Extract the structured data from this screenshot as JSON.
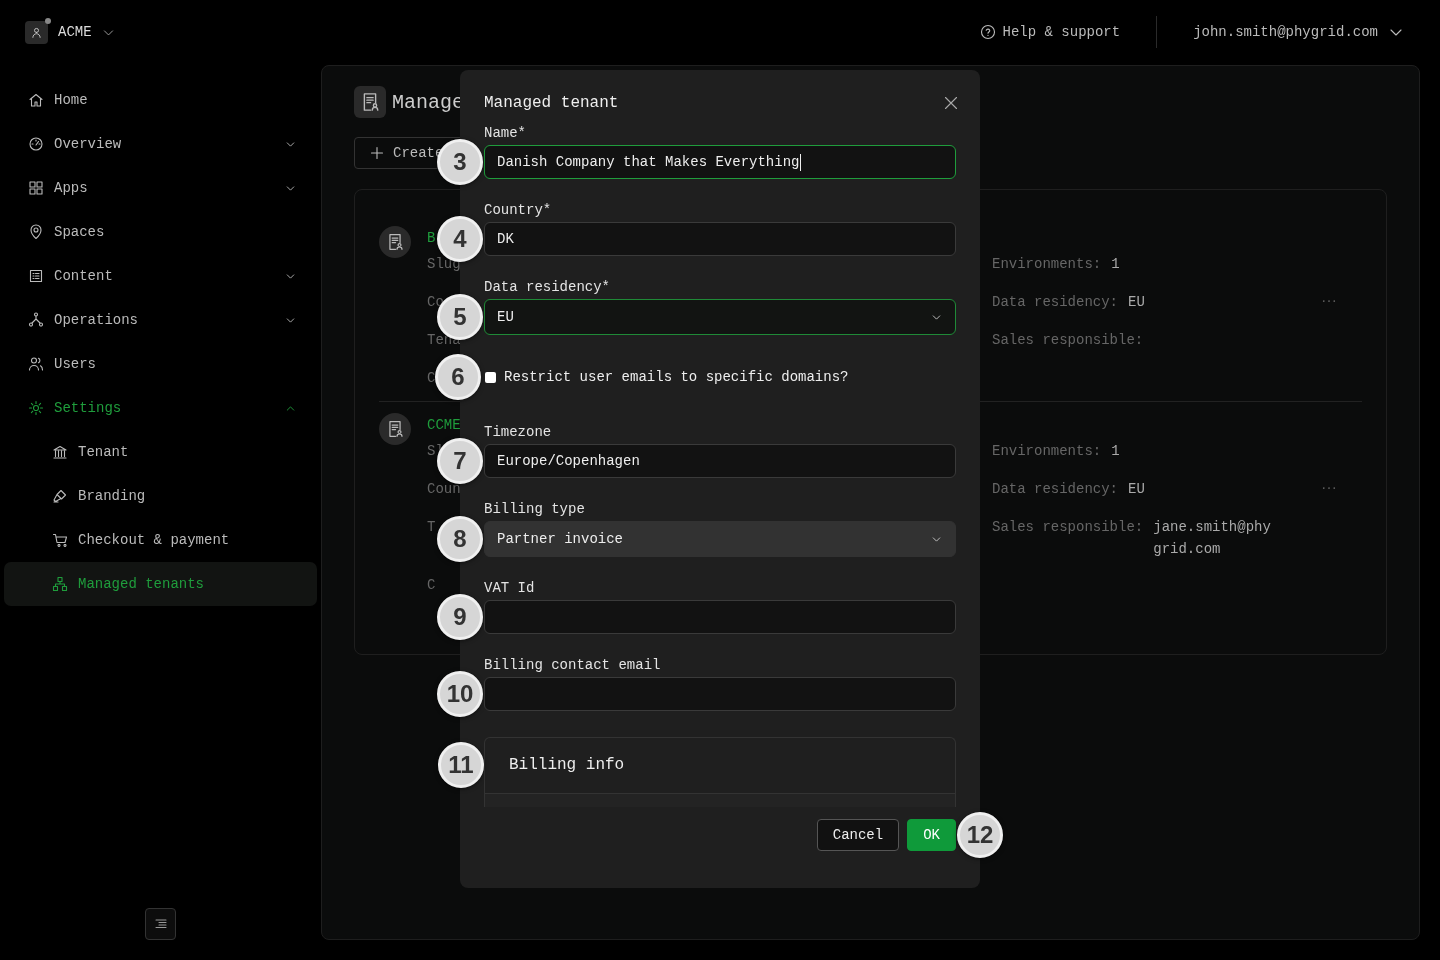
{
  "topbar": {
    "workspace": "ACME",
    "help": "Help & support",
    "user": "john.smith@phygrid.com"
  },
  "sidebar": {
    "items": [
      {
        "label": "Home",
        "kind": "link",
        "selected": false
      },
      {
        "label": "Overview",
        "kind": "group",
        "expanded": false,
        "selected": false
      },
      {
        "label": "Apps",
        "kind": "group",
        "expanded": false,
        "selected": false
      },
      {
        "label": "Spaces",
        "kind": "link",
        "selected": false
      },
      {
        "label": "Content",
        "kind": "group",
        "expanded": false,
        "selected": false
      },
      {
        "label": "Operations",
        "kind": "group",
        "expanded": false,
        "selected": false
      },
      {
        "label": "Users",
        "kind": "link",
        "selected": false
      },
      {
        "label": "Settings",
        "kind": "group",
        "expanded": true,
        "selected": true,
        "children": [
          {
            "label": "Tenant",
            "selected": false
          },
          {
            "label": "Branding",
            "selected": false
          },
          {
            "label": "Checkout & payment",
            "selected": false
          },
          {
            "label": "Managed tenants",
            "selected": true
          }
        ]
      }
    ]
  },
  "page": {
    "title": "Manage",
    "create_button": "Create",
    "tenants": [
      {
        "name": "B",
        "lines": [
          "Slug",
          "Co",
          "Tena",
          "C"
        ],
        "details": [
          {
            "label": "Environments:",
            "value": "1"
          },
          {
            "label": "Data residency:",
            "value": "EU"
          },
          {
            "label": "Sales responsible:"
          }
        ]
      },
      {
        "name": "CCME",
        "lines": [
          "Sl",
          "Coun",
          "T",
          "C"
        ],
        "details": [
          {
            "label": "Environments:",
            "value": "1"
          },
          {
            "label": "Data residency:",
            "value": "EU"
          },
          {
            "label": "Sales responsible:",
            "value": "jane.smith@phygrid.com"
          }
        ]
      }
    ]
  },
  "modal": {
    "title": "Managed tenant",
    "fields": [
      {
        "kind": "text",
        "label": "Name*",
        "value": "Danish Company that Makes Everything",
        "focused": true,
        "callout": "3"
      },
      {
        "kind": "text",
        "label": "Country*",
        "value": "DK",
        "focused": false,
        "callout": "4"
      },
      {
        "kind": "select",
        "label": "Data residency*",
        "value": "EU",
        "focused": true,
        "callout": "5"
      },
      {
        "kind": "checkbox",
        "label": "Restrict user emails to specific domains?",
        "checked": false,
        "callout": "6"
      },
      {
        "kind": "text",
        "label": "Timezone",
        "value": "Europe/Copenhagen",
        "focused": false,
        "callout": "7"
      },
      {
        "kind": "select",
        "label": "Billing type",
        "value": "Partner invoice",
        "focused": false,
        "callout": "8"
      },
      {
        "kind": "text",
        "label": "VAT Id",
        "focused": false,
        "callout": "9"
      },
      {
        "kind": "text",
        "label": "Billing contact email",
        "focused": false,
        "callout": "10"
      },
      {
        "kind": "section",
        "title": "Billing info",
        "callout": "11"
      }
    ],
    "buttons": [
      {
        "label": "Cancel",
        "kind": "secondary"
      },
      {
        "label": "OK",
        "kind": "primary",
        "callout": "12"
      }
    ]
  }
}
